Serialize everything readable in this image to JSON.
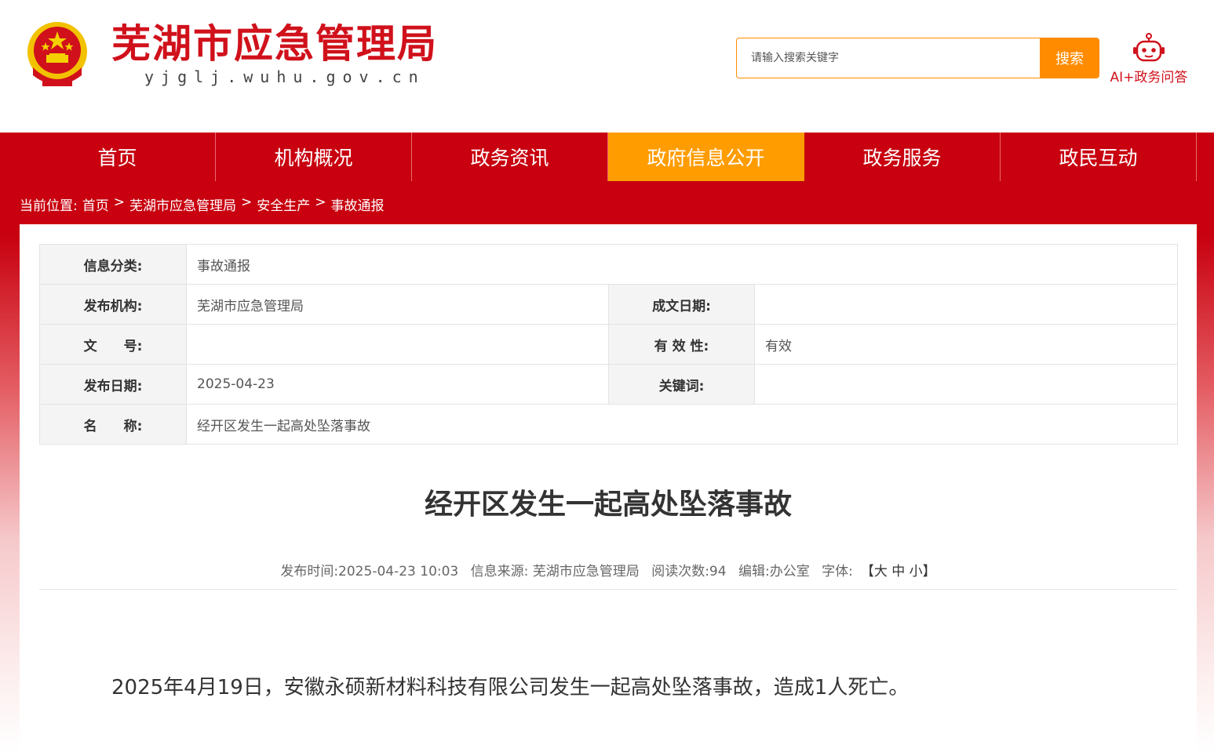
{
  "header": {
    "site_title": "芜湖市应急管理局",
    "site_domain": "yjglj.wuhu.gov.cn",
    "search_placeholder": "请输入搜索关键字",
    "search_button": "搜索",
    "ai_label": "AI+政务问答",
    "emblem_icon": "national-emblem-icon",
    "ai_icon": "robot-icon"
  },
  "nav": {
    "items": [
      "首页",
      "机构概况",
      "政务资讯",
      "政府信息公开",
      "政务服务",
      "政民互动"
    ],
    "active_index": 3
  },
  "breadcrumb": {
    "prefix": "当前位置:",
    "items": [
      "首页",
      "芜湖市应急管理局",
      "安全生产",
      "事故通报"
    ],
    "separator": ">"
  },
  "info": {
    "category_label": "信息分类:",
    "category_value": "事故通报",
    "org_label": "发布机构:",
    "org_value": "芜湖市应急管理局",
    "written_date_label": "成文日期:",
    "written_date_value": "",
    "doc_no_label": "文　　号:",
    "doc_no_value": "",
    "validity_label": "有 效 性:",
    "validity_value": "有效",
    "publish_date_label": "发布日期:",
    "publish_date_value": "2025-04-23",
    "keywords_label": "关键词:",
    "keywords_value": "",
    "name_label": "名　　称:",
    "name_value": "经开区发生一起高处坠落事故"
  },
  "article": {
    "title": "经开区发生一起高处坠落事故",
    "meta": {
      "publish_time": "发布时间:2025-04-23 10:03",
      "source": "信息来源: 芜湖市应急管理局",
      "views": "阅读次数:94",
      "editor": "编辑:办公室",
      "font_label": "字体:",
      "font_sizes": "【大 中 小】"
    },
    "body": "2025年4月19日，安徽永硕新材料科技有限公司发生一起高处坠落事故，造成1人死亡。"
  },
  "colors": {
    "brand_red": "#c8000f",
    "title_red": "#d0111b",
    "accent_orange": "#ff9c00"
  }
}
